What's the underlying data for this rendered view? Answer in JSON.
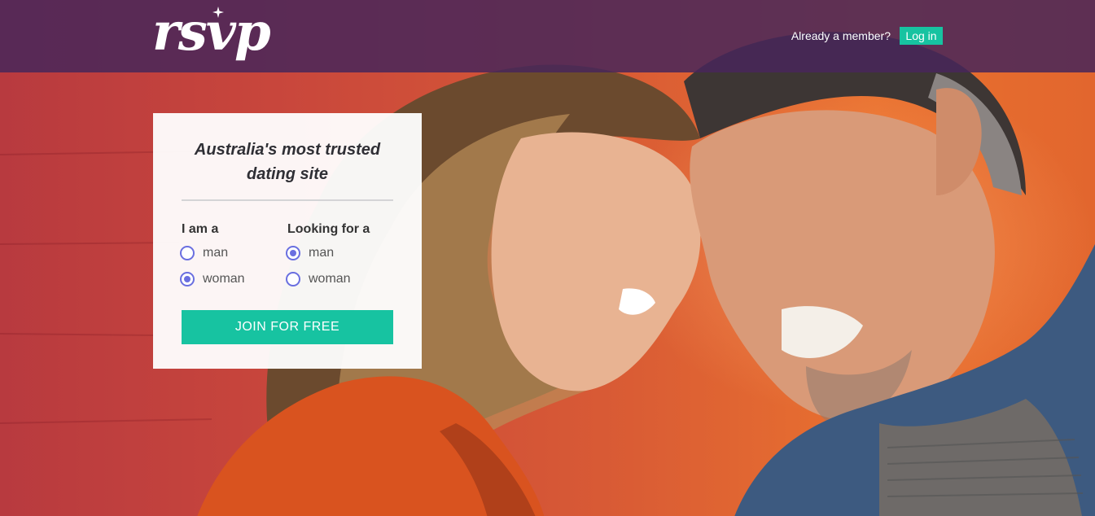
{
  "header": {
    "logo_text": "rsvp",
    "member_prompt": "Already a member?",
    "login_label": "Log in"
  },
  "signup": {
    "headline": "Australia's most trusted dating site",
    "i_am": {
      "label": "I am a",
      "options": [
        {
          "label": "man",
          "checked": false
        },
        {
          "label": "woman",
          "checked": true
        }
      ]
    },
    "looking_for": {
      "label": "Looking for a",
      "options": [
        {
          "label": "man",
          "checked": true
        },
        {
          "label": "woman",
          "checked": false
        }
      ]
    },
    "join_label": "JOIN FOR FREE"
  },
  "colors": {
    "header_bg": "#48265a",
    "accent": "#17c3a1",
    "radio": "#6a6fe0"
  },
  "hero_image": "couple-smiling-forehead-to-forehead-photo"
}
